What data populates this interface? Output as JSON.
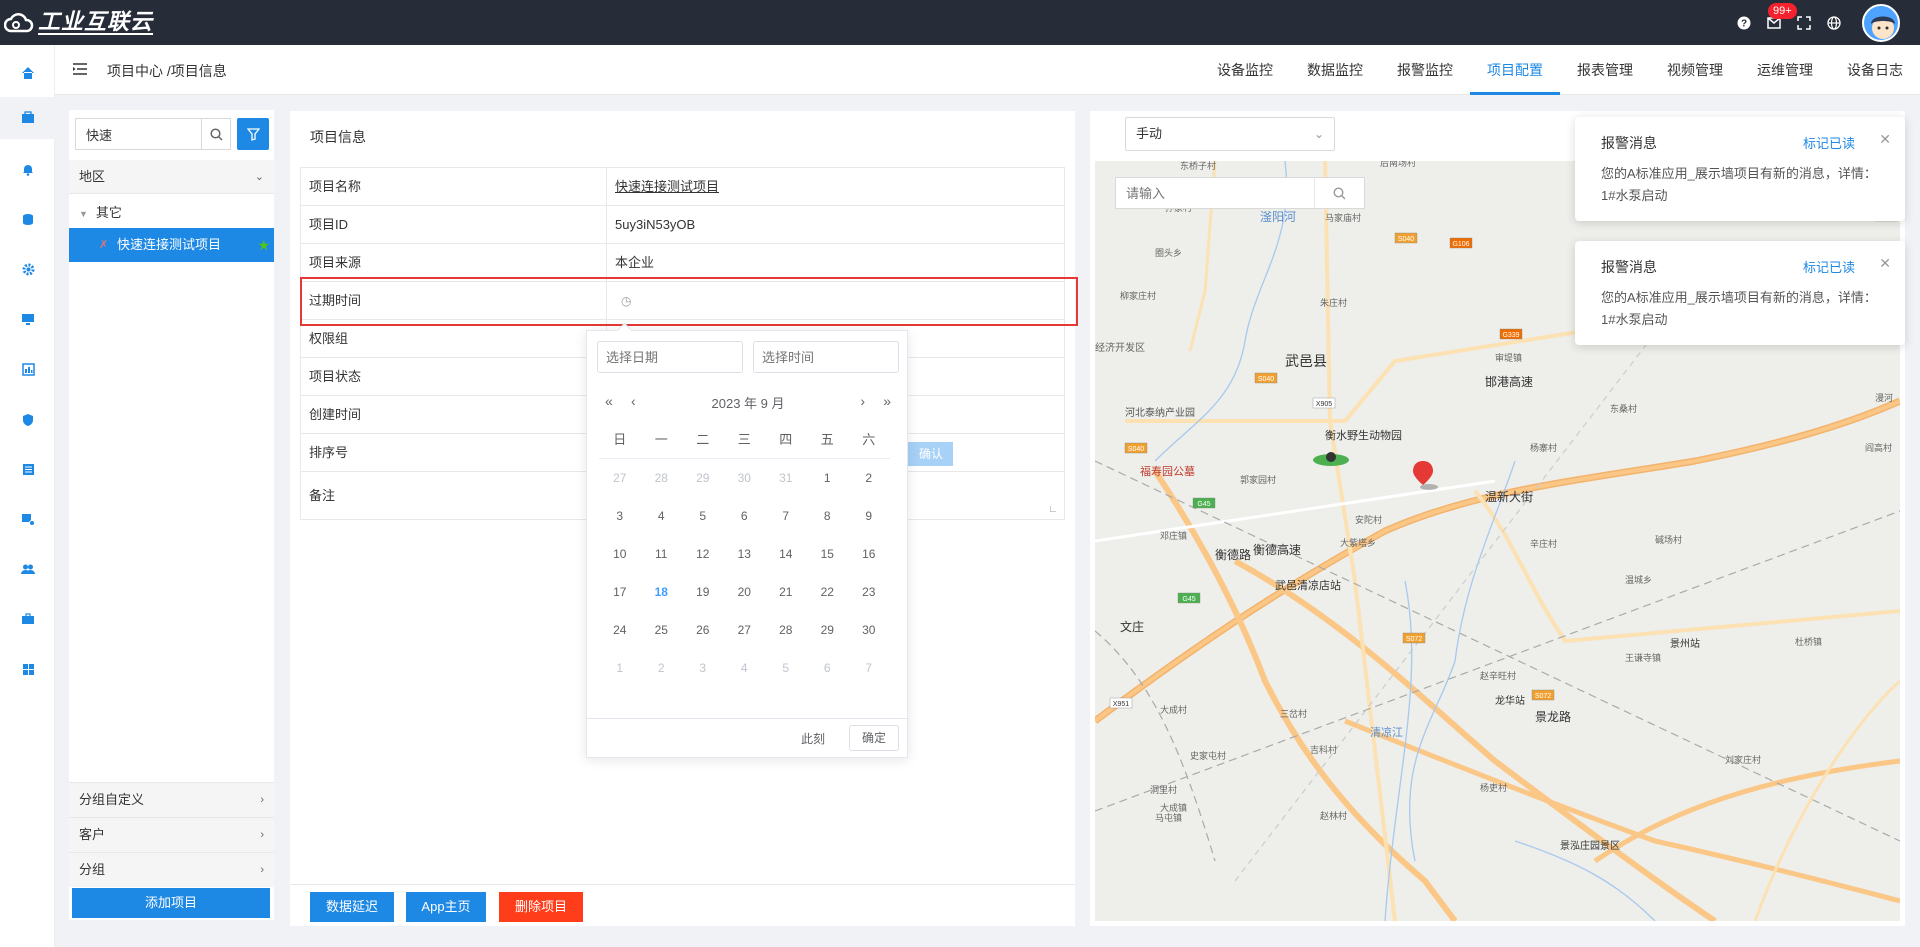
{
  "app": {
    "logo_text": "工业互联云",
    "notification_count": "99+"
  },
  "breadcrumb": "项目中心 /项目信息",
  "topnav": [
    {
      "label": "设备监控"
    },
    {
      "label": "数据监控"
    },
    {
      "label": "报警监控"
    },
    {
      "label": "项目配置",
      "active": true
    },
    {
      "label": "报表管理"
    },
    {
      "label": "视频管理"
    },
    {
      "label": "运维管理"
    },
    {
      "label": "设备日志"
    }
  ],
  "tree": {
    "search_value": "快速",
    "region_label": "地区",
    "node_other": "其它",
    "node_selected": "快速连接测试项目",
    "group_custom": "分组自定义",
    "group_customer": "客户",
    "group": "分组",
    "add_button": "添加项目"
  },
  "info": {
    "title": "项目信息",
    "rows": [
      {
        "label": "项目名称",
        "value": "快速连接测试项目"
      },
      {
        "label": "项目ID",
        "value": "5uy3iN53yOB"
      },
      {
        "label": "项目来源",
        "value": "本企业"
      },
      {
        "label": "过期时间",
        "value": ""
      },
      {
        "label": "权限组",
        "value": ""
      },
      {
        "label": "项目状态",
        "value": ""
      },
      {
        "label": "创建时间",
        "value": ""
      },
      {
        "label": "排序号",
        "value": ""
      },
      {
        "label": "备注",
        "value": ""
      }
    ],
    "confirm_ghost": "确认",
    "buttons": {
      "delay": "数据延迟",
      "app_home": "App主页",
      "delete": "删除项目"
    }
  },
  "picker": {
    "date_placeholder": "选择日期",
    "time_placeholder": "选择时间",
    "title": "2023 年  9 月",
    "weekdays": [
      "日",
      "一",
      "二",
      "三",
      "四",
      "五",
      "六"
    ],
    "weeks": [
      [
        "27",
        "28",
        "29",
        "30",
        "31",
        "1",
        "2"
      ],
      [
        "3",
        "4",
        "5",
        "6",
        "7",
        "8",
        "9"
      ],
      [
        "10",
        "11",
        "12",
        "13",
        "14",
        "15",
        "16"
      ],
      [
        "17",
        "18",
        "19",
        "20",
        "21",
        "22",
        "23"
      ],
      [
        "24",
        "25",
        "26",
        "27",
        "28",
        "29",
        "30"
      ],
      [
        "1",
        "2",
        "3",
        "4",
        "5",
        "6",
        "7"
      ]
    ],
    "today": "18",
    "now_label": "此刻",
    "ok_label": "确定"
  },
  "map": {
    "mode": "手动",
    "search_placeholder": "请输入",
    "places": [
      "武邑县",
      "衡水野生动物园",
      "河北泰纳产业园",
      "福寿园公墓",
      "武邑清凉店站",
      "邯港高速",
      "衡德路",
      "衡德高速",
      "前王曹村",
      "马家庙村",
      "朱庄村",
      "审堤镇",
      "杨寨村",
      "郭家园村",
      "安陀村",
      "大紫塔乡",
      "邓庄镇",
      "景州站",
      "龙华站",
      "景泓庄园景区",
      "清凉江",
      "王谦寺镇",
      "赵辛旺村",
      "三岔村",
      "吉科村",
      "大成村",
      "史家屯村",
      "马屯镇",
      "赵林村",
      "刘家庄村",
      "杜桥镇",
      "温城乡",
      "碱场村",
      "辛庄村",
      "东桑村",
      "圈头乡",
      "孙家村",
      "东桥子村",
      "柳家庄村",
      "经济开发区",
      "景龙路",
      "滏阳河",
      "阎高村",
      "漫河",
      "杨吏村",
      "洞里村",
      "文庄",
      "后南场村",
      "大成镇",
      "温新大街"
    ],
    "roads": [
      "S040",
      "G106",
      "G339",
      "S040",
      "X905",
      "S040",
      "G45",
      "S072",
      "G45",
      "S072",
      "X951",
      "S385"
    ]
  },
  "notifications": [
    {
      "title": "报警消息",
      "read_label": "标记已读",
      "body": "您的A标准应用_展示墙项目有新的消息，详情：1#水泵启动"
    },
    {
      "title": "报警消息",
      "read_label": "标记已读",
      "body": "您的A标准应用_展示墙项目有新的消息，详情：1#水泵启动"
    }
  ],
  "colors": {
    "accent": "#1e88e5",
    "danger": "#f5222d",
    "topbar": "#272c39",
    "highlight": "#e53935"
  }
}
